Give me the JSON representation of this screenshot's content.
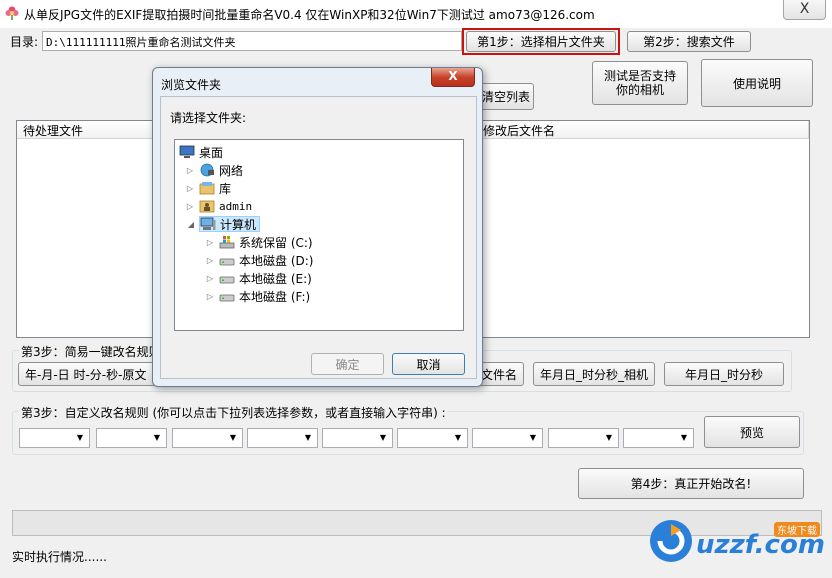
{
  "window": {
    "title": "从单反JPG文件的EXIF提取拍摄时间批量重命名V0.4    仅在WinXP和32位Win7下测试过    amo73@126.com",
    "close_label": "X"
  },
  "dir": {
    "label": "目录:",
    "value": "D:\\111111111照片重命名测试文件夹"
  },
  "buttons": {
    "step1": "第1步：选择相片文件夹",
    "step2": "第2步：搜索文件",
    "clear_list": "清空列表",
    "test_camera": "测试是否支持\n你的相机",
    "help": "使用说明",
    "preview": "预览",
    "step4": "第4步：真正开始改名!"
  },
  "lists": {
    "pending_header": "待处理文件",
    "renamed_header": "修改后文件名"
  },
  "step3a": {
    "label": "第3步：简易一键改名规则",
    "buttons": [
      "年-月-日 时-分-秒-原文",
      "文件名",
      "年月日_时分秒_相机",
      "年月日_时分秒"
    ]
  },
  "step3b": {
    "label": "第3步：自定义改名规则 (你可以点击下拉列表选择参数，或者直接输入字符串) :",
    "combos": [
      "",
      "",
      "",
      "",
      "",
      "",
      "",
      "",
      ""
    ]
  },
  "status": {
    "text": "实时执行情况......"
  },
  "dialog": {
    "title": "浏览文件夹",
    "close_label": "X",
    "prompt": "请选择文件夹:",
    "tree": [
      {
        "label": "桌面",
        "icon": "desktop-icon",
        "level": 0,
        "expander": ""
      },
      {
        "label": "网络",
        "icon": "network-icon",
        "level": 1,
        "expander": "▷"
      },
      {
        "label": "库",
        "icon": "library-icon",
        "level": 1,
        "expander": "▷"
      },
      {
        "label": "admin",
        "icon": "user-folder-icon",
        "level": 1,
        "expander": "▷"
      },
      {
        "label": "计算机",
        "icon": "computer-icon",
        "level": 1,
        "expander": "◢",
        "selected": true
      },
      {
        "label": "系统保留 (C:)",
        "icon": "system-drive-icon",
        "level": 2,
        "expander": "▷"
      },
      {
        "label": "本地磁盘 (D:)",
        "icon": "drive-icon",
        "level": 2,
        "expander": "▷"
      },
      {
        "label": "本地磁盘 (E:)",
        "icon": "drive-icon",
        "level": 2,
        "expander": "▷"
      },
      {
        "label": "本地磁盘 (F:)",
        "icon": "drive-icon",
        "level": 2,
        "expander": "▷"
      }
    ],
    "ok": "确定",
    "cancel": "取消"
  },
  "watermark": {
    "text": "uzzf.com",
    "sub": "东坡下载"
  },
  "colors": {
    "highlight_border": "#cc1111",
    "selection": "#cce8ff"
  }
}
